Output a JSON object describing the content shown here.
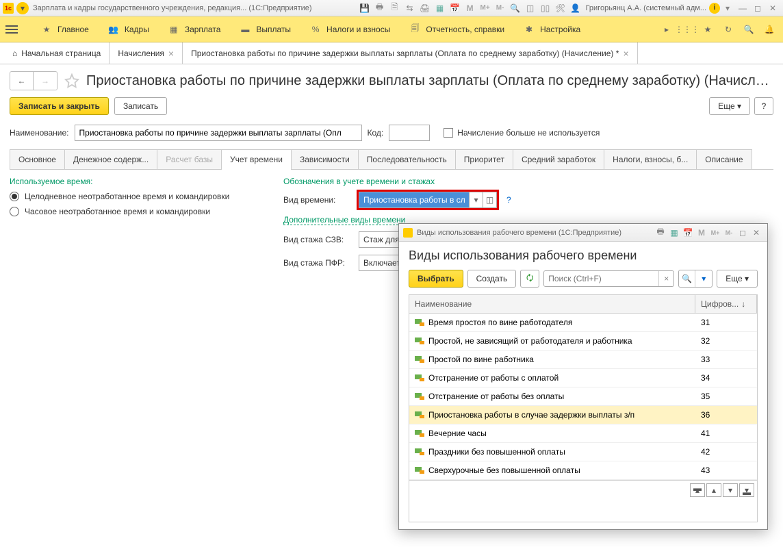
{
  "titlebar": {
    "app_title": "Зарплата и кадры государственного учреждения, редакция...  (1С:Предприятие)",
    "user": "Григорьянц А.А. (системный адм..."
  },
  "menu": {
    "items": [
      {
        "label": "Главное"
      },
      {
        "label": "Кадры"
      },
      {
        "label": "Зарплата"
      },
      {
        "label": "Выплаты"
      },
      {
        "label": "Налоги и взносы"
      },
      {
        "label": "Отчетность, справки"
      },
      {
        "label": "Настройка"
      }
    ]
  },
  "tabs": {
    "home": "Начальная страница",
    "t1": "Начисления",
    "t2": "Приостановка работы по причине задержки выплаты зарплаты (Оплата по среднему заработку) (Начисление) *"
  },
  "page": {
    "title": "Приостановка работы по причине задержки выплаты зарплаты (Оплата по среднему заработку) (Начислени..."
  },
  "toolbar": {
    "save_close": "Записать и закрыть",
    "save": "Записать",
    "more": "Еще",
    "help": "?"
  },
  "form": {
    "name_label": "Наименование:",
    "name_value": "Приостановка работы по причине задержки выплаты зарплаты (Опл",
    "code_label": "Код:",
    "not_used": "Начисление больше не используется"
  },
  "subtabs": [
    "Основное",
    "Денежное содерж...",
    "Расчет базы",
    "Учет времени",
    "Зависимости",
    "Последовательность",
    "Приоритет",
    "Средний заработок",
    "Налоги, взносы, б...",
    "Описание"
  ],
  "left": {
    "section": "Используемое время:",
    "r1": "Целодневное неотработанное время и командировки",
    "r2": "Часовое неотработанное время и командировки"
  },
  "right": {
    "section": "Обозначения в учете времени и стажах",
    "vid_label": "Вид времени:",
    "vid_value": "Приостановка работы в сл",
    "add_link": "Дополнительные виды времени",
    "szv_label": "Вид стажа СЗВ:",
    "szv_value": "Стаж для до",
    "pfr_label": "Вид стажа ПФР:",
    "pfr_value": "Включается"
  },
  "modal": {
    "win_title": "Виды использования рабочего времени (1С:Предприятие)",
    "title": "Виды использования рабочего времени",
    "select": "Выбрать",
    "create": "Создать",
    "search_placeholder": "Поиск (Ctrl+F)",
    "more": "Еще",
    "col_name": "Наименование",
    "col_code": "Цифров...",
    "rows": [
      {
        "name": "Время простоя по вине работодателя",
        "code": "31"
      },
      {
        "name": "Простой, не зависящий от работодателя и работника",
        "code": "32"
      },
      {
        "name": "Простой по вине работника",
        "code": "33"
      },
      {
        "name": "Отстранение от работы с оплатой",
        "code": "34"
      },
      {
        "name": "Отстранение от работы без оплаты",
        "code": "35"
      },
      {
        "name": "Приостановка работы в случае задержки выплаты з/п",
        "code": "36"
      },
      {
        "name": "Вечерние часы",
        "code": "41"
      },
      {
        "name": "Праздники без повышенной оплаты",
        "code": "42"
      },
      {
        "name": "Сверхурочные без повышенной оплаты",
        "code": "43"
      }
    ],
    "selected_index": 5
  }
}
